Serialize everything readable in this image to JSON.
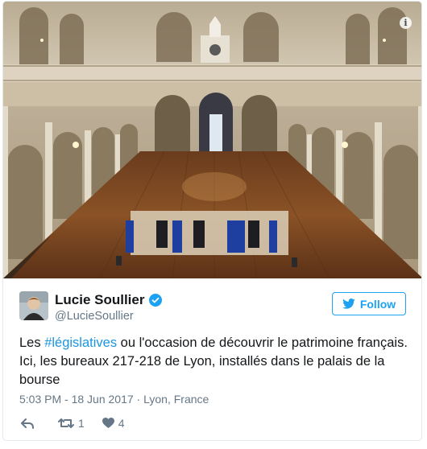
{
  "media": {
    "info_icon": "info-icon",
    "image": "photo of polling station in historic hall"
  },
  "author": {
    "name": "Lucie Soullier",
    "handle": "@LucieSoullier",
    "verified_icon": "verified-badge-icon"
  },
  "follow": {
    "label": "Follow",
    "icon": "twitter-bird-icon"
  },
  "tweet": {
    "text_before": "Les ",
    "hashtag": "#législatives",
    "text_after": " ou l'occasion de découvrir le patrimoine français. Ici, les bureaux 217-218 de Lyon, installés dans le palais de la bourse"
  },
  "meta": {
    "timestamp": "5:03 PM - 18 Jun 2017",
    "separator": " · ",
    "location": "Lyon, France"
  },
  "actions": {
    "reply_icon": "reply-icon",
    "retweet_icon": "retweet-icon",
    "retweet_count": "1",
    "like_icon": "heart-icon",
    "like_count": "4"
  },
  "colors": {
    "accent": "#1da1f2",
    "hashtag": "#1b95e0",
    "muted": "#657786",
    "border": "#e1e8ed"
  }
}
